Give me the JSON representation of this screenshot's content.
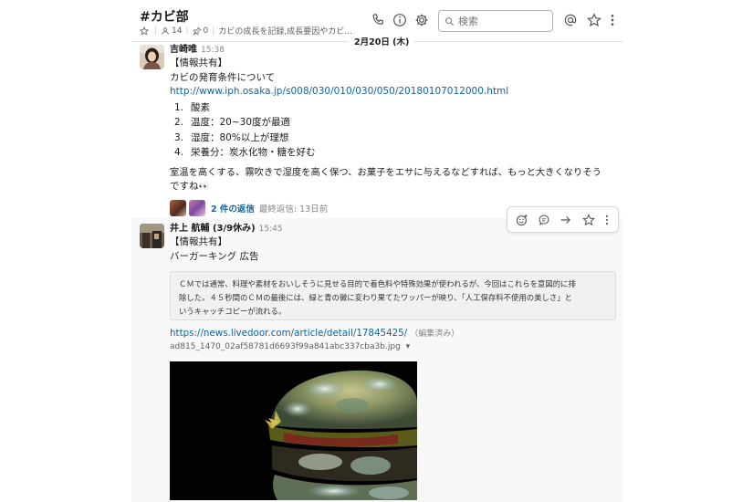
{
  "header": {
    "channel_name": "#カビ部",
    "members_count": "14",
    "pins_count": "0",
    "topic": "カビの成長を記録,成長要因やカビ...",
    "search_placeholder": "検索"
  },
  "date_divider": "2月20日 (木)",
  "messages": [
    {
      "author": "吉崎唯",
      "time": "15:38",
      "lines": [
        "【情報共有】",
        "カビの発育条件について"
      ],
      "link": "http://www.iph.osaka.jp/s008/030/010/030/050/20180107012000.html",
      "list": [
        {
          "num": "1.",
          "text": "酸素"
        },
        {
          "num": "2.",
          "text": "温度：20~30度が最適"
        },
        {
          "num": "3.",
          "text": "湿度：80%以上が理想"
        },
        {
          "num": "4.",
          "text": "栄養分：炭水化物・糖を好む"
        }
      ],
      "paragraph_1": "室温を高くする、霧吹きで湿度を高く保つ、お菓子をエサに与えるなどすれば、もっと大きくなりそう",
      "paragraph_2": "ですね",
      "emoji": "👀",
      "replies_label": "2 件の返信",
      "last_reply": "最終返信: 13日前"
    },
    {
      "author": "井上 航輔 (3/9休み)",
      "time": "15:45",
      "lines": [
        "【情報共有】",
        "バーガーキング  広告"
      ],
      "quote": [
        "ＣＭでは通常、料理や素材をおいしそうに見せる目的で着色料や特殊効果が使われるが、今回はこれらを意図的に排",
        "除した。４５秒間のＣＭの最後には、緑と青の黴に変わり果てたワッパーが映り、「人工保存料不使用の美しさ」と",
        "いうキャッチコピーが流れる。"
      ],
      "link": "https://news.livedoor.com/article/detail/17845425/",
      "edited": "（編集済み）",
      "file_name": "ad815_1470_02af58781d6693f99a841abc337cba3b.jpg",
      "file_caret": "▾"
    }
  ],
  "icons": [
    "star-icon",
    "person-icon",
    "pin-icon",
    "phone-icon",
    "info-icon",
    "gear-icon",
    "search-icon",
    "mention-icon",
    "more-vertical-icon",
    "emoji-reaction-icon",
    "reply-thread-icon",
    "share-icon",
    "bookmark-icon"
  ],
  "colors": {
    "link": "#1264a3",
    "hover_bg": "#f8f8f8",
    "text": "#1d1c1d",
    "muted": "#868686"
  }
}
